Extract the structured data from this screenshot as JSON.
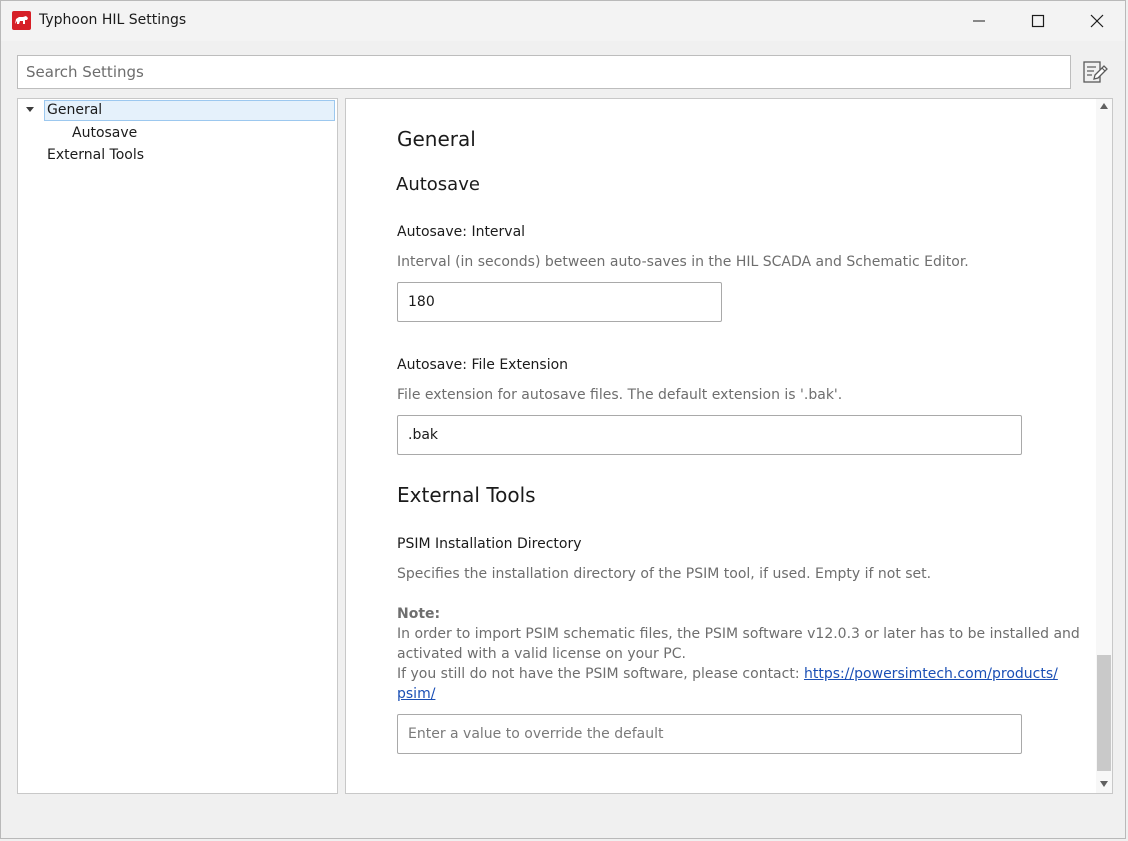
{
  "window": {
    "title": "Typhoon HIL Settings",
    "controls": {
      "minimize": "minimize-icon",
      "maximize": "maximize-icon",
      "close": "close-icon"
    }
  },
  "search": {
    "placeholder": "Search Settings",
    "value": ""
  },
  "tree": {
    "items": [
      {
        "label": "General",
        "expanded": true,
        "selected": true
      },
      {
        "label": "Autosave",
        "level": 2
      },
      {
        "label": "External Tools"
      }
    ]
  },
  "content": {
    "general_heading": "General",
    "autosave_heading": "Autosave",
    "interval": {
      "label": "Autosave: Interval",
      "description": "Interval (in seconds) between auto-saves in the HIL SCADA and Schematic Editor.",
      "value": "180"
    },
    "file_extension": {
      "label": "Autosave: File Extension",
      "description": "File extension for autosave files. The default extension is '.bak'.",
      "value": ".bak"
    },
    "external_tools_heading": "External Tools",
    "psim": {
      "label": "PSIM Installation Directory",
      "description": "Specifies the installation directory of the PSIM tool, if used. Empty if not set.",
      "note_title": "Note:",
      "note_line1": "In order to import PSIM schematic files, the PSIM software v12.0.3 or later has to be installed and",
      "note_line2": "activated with a valid license on your PC.",
      "note_line3_prefix": "If you still do not have the PSIM software, please contact: ",
      "note_link_part1": "https://powersimtech.com/products/",
      "note_link_part2": "psim/",
      "placeholder": "Enter a value to override the default",
      "value": ""
    }
  },
  "colors": {
    "accent": "#d61f26",
    "selection": "#e5f1fb",
    "link": "#1a4fb5"
  }
}
